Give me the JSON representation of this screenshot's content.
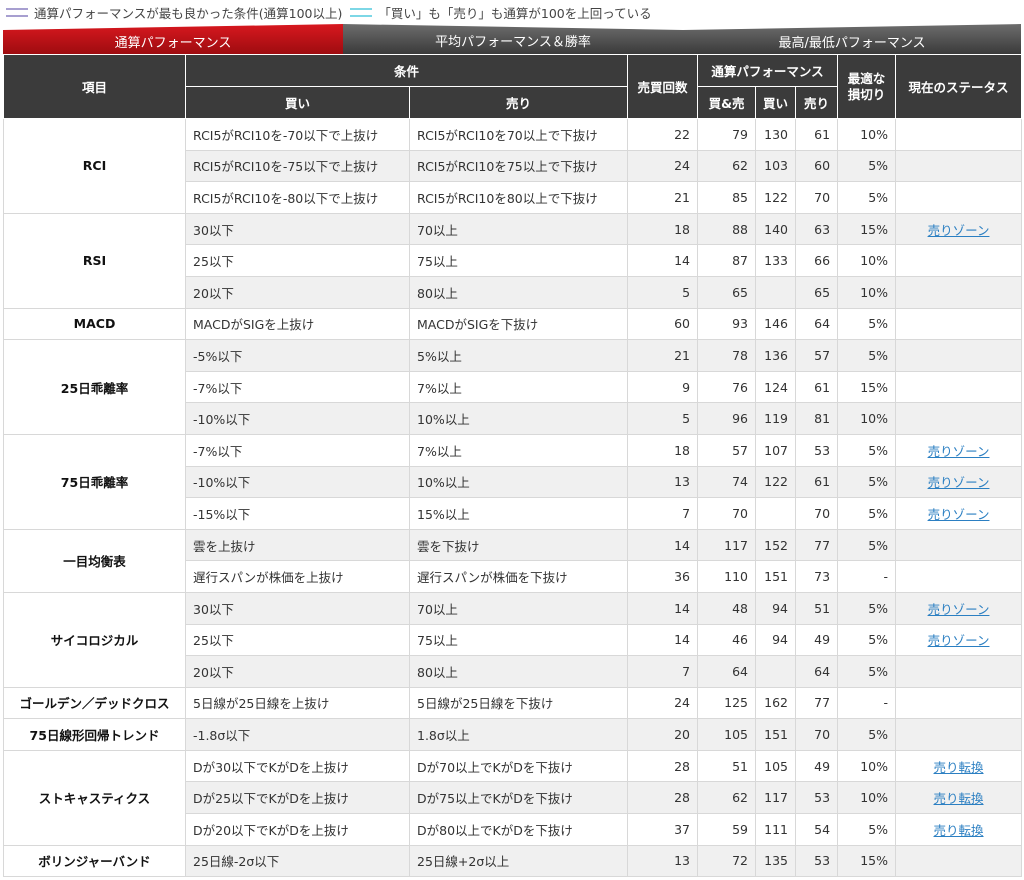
{
  "legend": {
    "item1": "通算パフォーマンスが最も良かった条件(通算100以上)",
    "item2": "「買い」も「売り」も通算が100を上回っている"
  },
  "tabs": [
    "通算パフォーマンス",
    "平均パフォーマンス＆勝率",
    "最高/最低パフォーマンス"
  ],
  "headers": {
    "item": "項目",
    "condition": "条件",
    "buy": "買い",
    "sell": "売り",
    "trades": "売買回数",
    "performance": "通算パフォーマンス",
    "both": "買&売",
    "perf_buy": "買い",
    "perf_sell": "売り",
    "stoploss_line1": "最適な",
    "stoploss_line2": "損切り",
    "status": "現在のステータス"
  },
  "groups": [
    {
      "name": "RCI",
      "rows": [
        {
          "buy": "RCI5がRCI10を-70以下で上抜け",
          "sell": "RCI5がRCI10を70以上で下抜け",
          "trades": "22",
          "both": "79",
          "pbuy": "130",
          "psell": "61",
          "stop": "10%",
          "status": ""
        },
        {
          "buy": "RCI5がRCI10を-75以下で上抜け",
          "sell": "RCI5がRCI10を75以上で下抜け",
          "trades": "24",
          "both": "62",
          "pbuy": "103",
          "psell": "60",
          "stop": "5%",
          "status": ""
        },
        {
          "buy": "RCI5がRCI10を-80以下で上抜け",
          "sell": "RCI5がRCI10を80以上で下抜け",
          "trades": "21",
          "both": "85",
          "pbuy": "122",
          "psell": "70",
          "stop": "5%",
          "status": ""
        }
      ]
    },
    {
      "name": "RSI",
      "rows": [
        {
          "buy": "30以下",
          "sell": "70以上",
          "trades": "18",
          "both": "88",
          "pbuy": "140",
          "psell": "63",
          "stop": "15%",
          "status": "売りゾーン"
        },
        {
          "buy": "25以下",
          "sell": "75以上",
          "trades": "14",
          "both": "87",
          "pbuy": "133",
          "psell": "66",
          "stop": "10%",
          "status": ""
        },
        {
          "buy": "20以下",
          "sell": "80以上",
          "trades": "5",
          "both": "65",
          "pbuy": "",
          "psell": "65",
          "stop": "10%",
          "status": ""
        }
      ]
    },
    {
      "name": "MACD",
      "rows": [
        {
          "buy": "MACDがSIGを上抜け",
          "sell": "MACDがSIGを下抜け",
          "trades": "60",
          "both": "93",
          "pbuy": "146",
          "psell": "64",
          "stop": "5%",
          "status": ""
        }
      ]
    },
    {
      "name": "25日乖離率",
      "rows": [
        {
          "buy": "-5%以下",
          "sell": "5%以上",
          "trades": "21",
          "both": "78",
          "pbuy": "136",
          "psell": "57",
          "stop": "5%",
          "status": ""
        },
        {
          "buy": "-7%以下",
          "sell": "7%以上",
          "trades": "9",
          "both": "76",
          "pbuy": "124",
          "psell": "61",
          "stop": "15%",
          "status": ""
        },
        {
          "buy": "-10%以下",
          "sell": "10%以上",
          "trades": "5",
          "both": "96",
          "pbuy": "119",
          "psell": "81",
          "stop": "10%",
          "status": ""
        }
      ]
    },
    {
      "name": "75日乖離率",
      "rows": [
        {
          "buy": "-7%以下",
          "sell": "7%以上",
          "trades": "18",
          "both": "57",
          "pbuy": "107",
          "psell": "53",
          "stop": "5%",
          "status": "売りゾーン"
        },
        {
          "buy": "-10%以下",
          "sell": "10%以上",
          "trades": "13",
          "both": "74",
          "pbuy": "122",
          "psell": "61",
          "stop": "5%",
          "status": "売りゾーン"
        },
        {
          "buy": "-15%以下",
          "sell": "15%以上",
          "trades": "7",
          "both": "70",
          "pbuy": "",
          "psell": "70",
          "stop": "5%",
          "status": "売りゾーン"
        }
      ]
    },
    {
      "name": "一目均衡表",
      "rows": [
        {
          "buy": "雲を上抜け",
          "sell": "雲を下抜け",
          "trades": "14",
          "both": "117",
          "pbuy": "152",
          "psell": "77",
          "stop": "5%",
          "status": ""
        },
        {
          "buy": "遅行スパンが株価を上抜け",
          "sell": "遅行スパンが株価を下抜け",
          "trades": "36",
          "both": "110",
          "pbuy": "151",
          "psell": "73",
          "stop": "-",
          "status": ""
        }
      ]
    },
    {
      "name": "サイコロジカル",
      "rows": [
        {
          "buy": "30以下",
          "sell": "70以上",
          "trades": "14",
          "both": "48",
          "pbuy": "94",
          "psell": "51",
          "stop": "5%",
          "status": "売りゾーン"
        },
        {
          "buy": "25以下",
          "sell": "75以上",
          "trades": "14",
          "both": "46",
          "pbuy": "94",
          "psell": "49",
          "stop": "5%",
          "status": "売りゾーン"
        },
        {
          "buy": "20以下",
          "sell": "80以上",
          "trades": "7",
          "both": "64",
          "pbuy": "",
          "psell": "64",
          "stop": "5%",
          "status": ""
        }
      ]
    },
    {
      "name": "ゴールデン／デッドクロス",
      "rows": [
        {
          "buy": "5日線が25日線を上抜け",
          "sell": "5日線が25日線を下抜け",
          "trades": "24",
          "both": "125",
          "pbuy": "162",
          "psell": "77",
          "stop": "-",
          "status": ""
        }
      ]
    },
    {
      "name": "75日線形回帰トレンド",
      "rows": [
        {
          "buy": "-1.8σ以下",
          "sell": "1.8σ以上",
          "trades": "20",
          "both": "105",
          "pbuy": "151",
          "psell": "70",
          "stop": "5%",
          "status": ""
        }
      ]
    },
    {
      "name": "ストキャスティクス",
      "rows": [
        {
          "buy": "Dが30以下でKがDを上抜け",
          "sell": "Dが70以上でKがDを下抜け",
          "trades": "28",
          "both": "51",
          "pbuy": "105",
          "psell": "49",
          "stop": "10%",
          "status": "売り転換"
        },
        {
          "buy": "Dが25以下でKがDを上抜け",
          "sell": "Dが75以上でKがDを下抜け",
          "trades": "28",
          "both": "62",
          "pbuy": "117",
          "psell": "53",
          "stop": "10%",
          "status": "売り転換"
        },
        {
          "buy": "Dが20以下でKがDを上抜け",
          "sell": "Dが80以上でKがDを下抜け",
          "trades": "37",
          "both": "59",
          "pbuy": "111",
          "psell": "54",
          "stop": "5%",
          "status": "売り転換"
        }
      ]
    },
    {
      "name": "ボリンジャーバンド",
      "rows": [
        {
          "buy": "25日線-2σ以下",
          "sell": "25日線+2σ以上",
          "trades": "13",
          "both": "72",
          "pbuy": "135",
          "psell": "53",
          "stop": "15%",
          "status": ""
        }
      ]
    }
  ]
}
